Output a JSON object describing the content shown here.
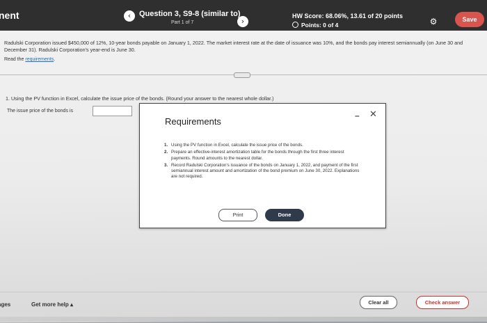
{
  "header": {
    "brand": "nent",
    "question_title": "Question 3, S9-8 (similar to)",
    "question_part": "Part 1 of 7",
    "hw_score": "HW Score: 68.06%, 13.61 of 20 points",
    "points": "Points: 0 of 4",
    "save_label": "Save",
    "prev_icon": "chevron-left-icon",
    "next_icon": "chevron-right-icon",
    "settings_icon": "gear-icon"
  },
  "problem": {
    "intro": "Radulski Corporation issued $450,000 of 12%, 10-year bonds payable on January 1, 2022. The market interest rate at the date of issuance was 10%, and the bonds pay interest semiannually (on June 30 and December 31). Radulski Corporation's year-end is June 30.",
    "read_prefix": "Read the ",
    "read_link": "requirements",
    "read_suffix": "."
  },
  "question": {
    "prompt": "1. Using the PV function in Excel, calculate the issue price of the bonds. (Round your answer to the nearest whole dollar.)",
    "issue_label": "The issue price of the bonds is",
    "answer_value": ""
  },
  "modal": {
    "title": "Requirements",
    "items": [
      {
        "num": "1.",
        "text": "Using the PV function in Excel, calculate the issue price of the bonds."
      },
      {
        "num": "2.",
        "text": "Prepare an effective-interest amortization table for the bonds through the first three interest payments. Round amounts to the nearest dollar."
      },
      {
        "num": "3.",
        "text": "Record Radulski Corporation's issuance of the bonds on January 1, 2022, and payment of the first semiannual interest amount and amortization of the bond premium on June 30, 2022. Explanations are not required."
      }
    ],
    "print_label": "Print",
    "done_label": "Done"
  },
  "footer": {
    "pages_label": "ages",
    "help_label": "Get more help ▴",
    "clear_label": "Clear all",
    "check_label": "Check answer"
  }
}
